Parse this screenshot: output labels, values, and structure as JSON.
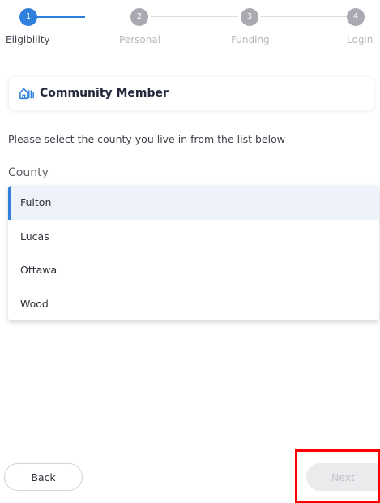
{
  "stepper": {
    "active_color": "#2f7fdc",
    "inactive_color": "#a9a9b1",
    "line_active_color": "#2f7fdc",
    "line_inactive_color": "#c9c9cf",
    "steps": [
      {
        "number": "1",
        "label": "Eligibility",
        "state": "active"
      },
      {
        "number": "2",
        "label": "Personal",
        "state": "upcoming"
      },
      {
        "number": "3",
        "label": "Funding",
        "state": "upcoming"
      },
      {
        "number": "4",
        "label": "Login",
        "state": "upcoming"
      }
    ]
  },
  "member_card": {
    "icon": "community-houses-icon",
    "title": "Community Member",
    "accent": "#2f7fdc"
  },
  "instructions": "Please select the county you live in from the list below",
  "county": {
    "label": "County",
    "selected": "Fulton",
    "options": [
      "Fulton",
      "Lucas",
      "Ottawa",
      "Wood"
    ]
  },
  "footer": {
    "back_label": "Back",
    "next_label": "Next",
    "next_disabled": true,
    "highlight_color": "#ff0000"
  }
}
